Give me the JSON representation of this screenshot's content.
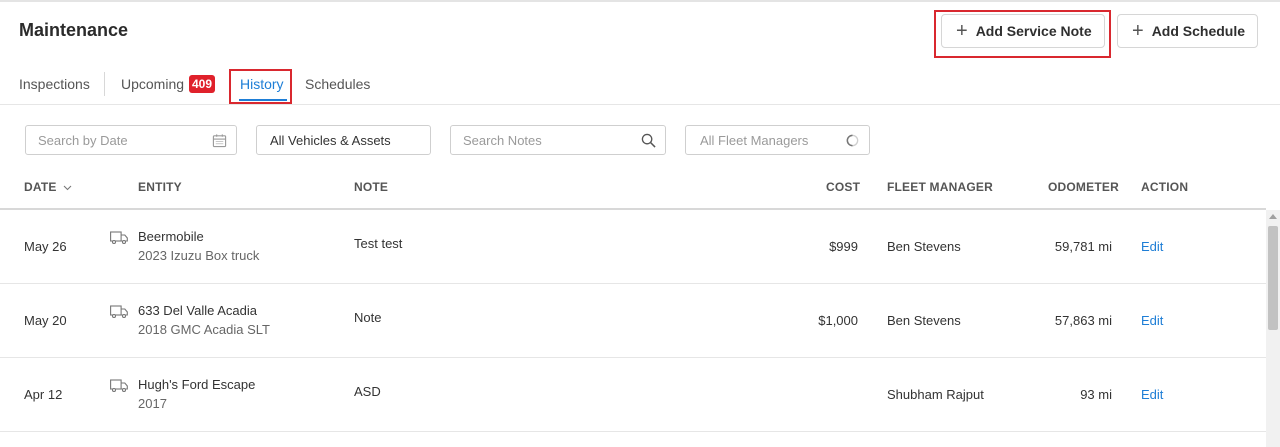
{
  "page": {
    "title": "Maintenance"
  },
  "header_buttons": {
    "add_service_note": "Add Service Note",
    "add_schedule": "Add Schedule"
  },
  "tabs": {
    "inspections": "Inspections",
    "upcoming": "Upcoming",
    "upcoming_count": "409",
    "history": "History",
    "schedules": "Schedules",
    "active": "History"
  },
  "filters": {
    "date_placeholder": "Search by Date",
    "vehicles_value": "All Vehicles & Assets",
    "notes_placeholder": "Search Notes",
    "managers_placeholder": "All Fleet Managers"
  },
  "table": {
    "headers": {
      "date": "DATE",
      "entity": "ENTITY",
      "note": "NOTE",
      "cost": "COST",
      "fleet_manager": "FLEET MANAGER",
      "odometer": "ODOMETER",
      "action": "ACTION"
    },
    "rows": [
      {
        "date": "May 26",
        "entity_name": "Beermobile",
        "entity_sub": "2023 Izuzu Box truck",
        "note": "Test test",
        "cost": "$999",
        "fleet_manager": "Ben Stevens",
        "odometer": "59,781 mi",
        "action": "Edit"
      },
      {
        "date": "May 20",
        "entity_name": "633 Del Valle Acadia",
        "entity_sub": "2018 GMC Acadia SLT",
        "note": "Note",
        "cost": "$1,000",
        "fleet_manager": "Ben Stevens",
        "odometer": "57,863 mi",
        "action": "Edit"
      },
      {
        "date": "Apr 12",
        "entity_name": "Hugh's Ford Escape",
        "entity_sub": "2017",
        "note": "ASD",
        "cost": "",
        "fleet_manager": "Shubham Rajput",
        "odometer": "93 mi",
        "action": "Edit"
      }
    ]
  },
  "colors": {
    "accent": "#1e7ed6",
    "badge": "#e0212b",
    "highlight": "#d9282f"
  }
}
